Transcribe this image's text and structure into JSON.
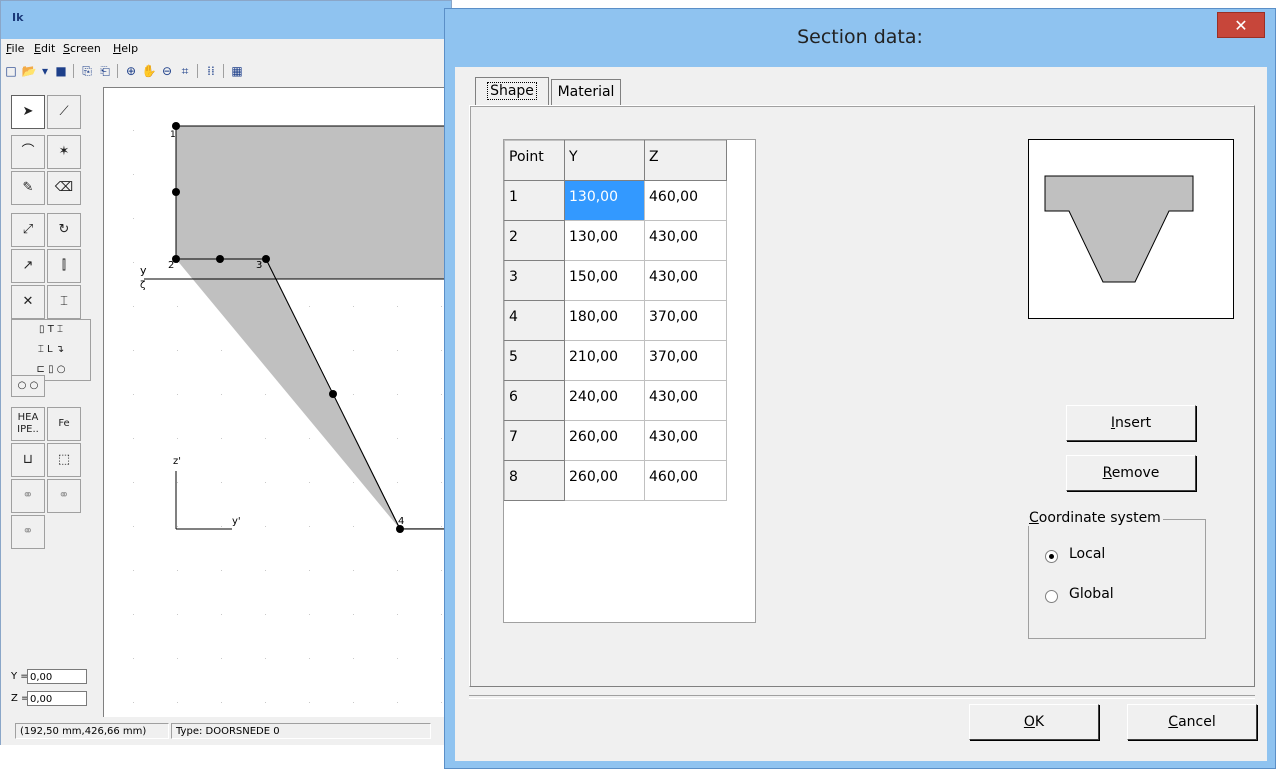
{
  "app": {
    "logo": "Ik",
    "menu": [
      "File",
      "Edit",
      "Screen",
      "Help"
    ],
    "menu_underline": [
      "F",
      "E",
      "S",
      "H"
    ],
    "coord_y_label": "Y =",
    "coord_y_value": "0,00",
    "coord_z_label": "Z =",
    "coord_z_value": "0,00",
    "status_position": "(192,50 mm,426,66 mm)",
    "status_type": "Type: DOORSNEDE 0",
    "palette_labels": {
      "hea_ipe": "HEA IPE..",
      "fe": "Fe"
    },
    "canvas": {
      "axis_y": "y",
      "axis_zeta": "ζ",
      "axis_z_prime": "z'",
      "axis_y_prime": "y'",
      "point_labels": [
        "1",
        "2",
        "3",
        "4"
      ]
    }
  },
  "dialog": {
    "title": "Section data:",
    "close_symbol": "✕",
    "tabs": [
      "Shape",
      "Material"
    ],
    "grid": {
      "headers": [
        "Point",
        "Y",
        "Z"
      ],
      "rows": [
        [
          "1",
          "130,00",
          "460,00"
        ],
        [
          "2",
          "130,00",
          "430,00"
        ],
        [
          "3",
          "150,00",
          "430,00"
        ],
        [
          "4",
          "180,00",
          "370,00"
        ],
        [
          "5",
          "210,00",
          "370,00"
        ],
        [
          "6",
          "240,00",
          "430,00"
        ],
        [
          "7",
          "260,00",
          "430,00"
        ],
        [
          "8",
          "260,00",
          "460,00"
        ]
      ]
    },
    "insert_label": "Insert",
    "remove_label": "Remove",
    "coord_system_label": "Coordinate system",
    "local_label": "Local",
    "global_label": "Global",
    "selected_coord_system": "Local",
    "ok_label": "OK",
    "cancel_label": "Cancel"
  },
  "colors": {
    "title_bar": "#8fc3f0",
    "close_button": "#c7463a",
    "selection": "#3399ff",
    "shape_fill": "#c0c0c0"
  }
}
